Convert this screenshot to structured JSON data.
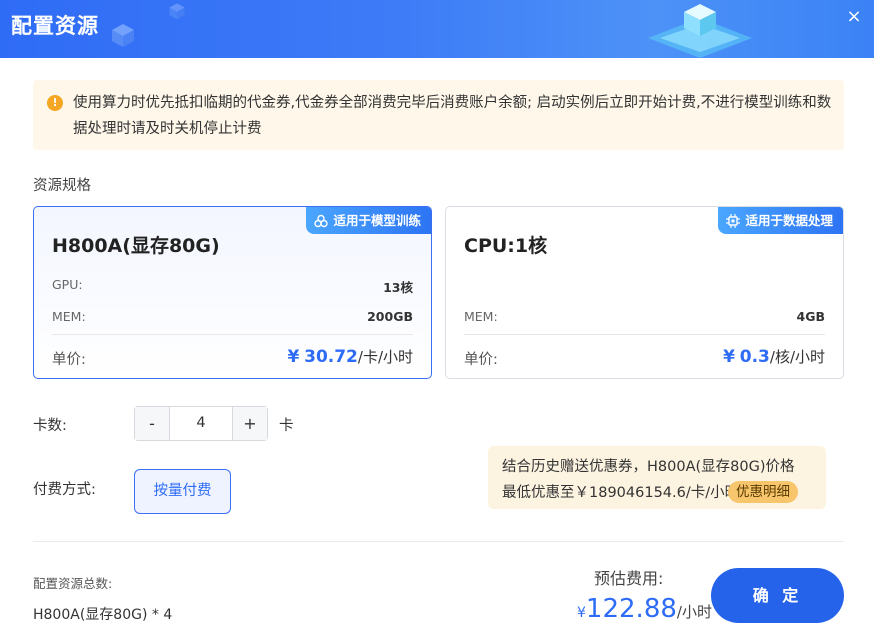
{
  "dialog": {
    "title": "配置资源",
    "close_icon": "×"
  },
  "notice": {
    "icon": "!",
    "text": "使用算力时优先抵扣临期的代金券,代金券全部消费完毕后消费账户余额; 启动实例后立即开始计费,不进行模型训练和数据处理时请及时关机停止计费"
  },
  "spec": {
    "section_label": "资源规格",
    "cards": [
      {
        "tag": "适用于模型训练",
        "name": "H800A(显存80G)",
        "gpu_label": "GPU:",
        "gpu_value": "13核",
        "mem_label": "MEM:",
        "mem_value": "200GB",
        "price_label": "单价:",
        "price_symbol": "¥",
        "price_value": "30.72",
        "price_unit": "/卡/小时",
        "selected": true
      },
      {
        "tag": "适用于数据处理",
        "name": "CPU:1核",
        "mem_label": "MEM:",
        "mem_value": "4GB",
        "price_label": "单价:",
        "price_symbol": "¥",
        "price_value": "0.3",
        "price_unit": "/核/小时",
        "selected": false
      }
    ]
  },
  "quantity": {
    "label": "卡数:",
    "minus": "-",
    "value": "4",
    "plus": "+",
    "unit": "卡"
  },
  "payment": {
    "label": "付费方式:",
    "option": "按量付费"
  },
  "promo": {
    "line1": "结合历史赠送优惠券，H800A(显存80G)价格",
    "line2": "最低优惠至￥189046154.6/卡/小时",
    "detail_button": "优惠明细"
  },
  "summary": {
    "total_label": "配置资源总数:",
    "total_value": "H800A(显存80G) * 4",
    "estimate_label": "预估费用:",
    "estimate_currency": "¥",
    "estimate_value": "122.88",
    "estimate_unit": "/小时",
    "confirm_button": "确 定"
  },
  "colors": {
    "accent": "#2f6cf6",
    "notice_bg": "#fef7ea",
    "promo_bg": "#fdf3e1",
    "warn": "#f5a623"
  }
}
